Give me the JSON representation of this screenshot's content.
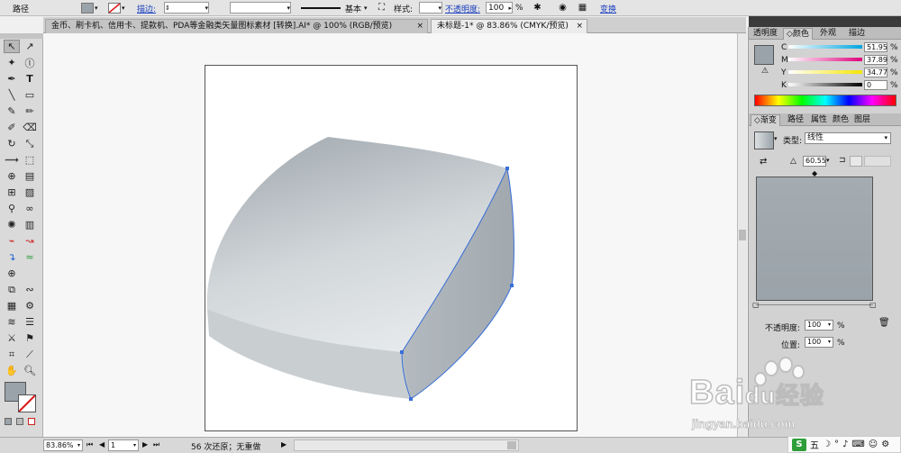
{
  "control_bar": {
    "object_type": "路径",
    "stroke_label": "描边:",
    "stroke_style": "基本",
    "style_label": "样式:",
    "opacity_label": "不透明度:",
    "opacity_value": "100",
    "opacity_unit": "%",
    "transform_label": "变换"
  },
  "tabs": [
    {
      "label": "金币、刷卡机、信用卡、提款机、PDA等金融类矢量图标素材 [转换].AI* @ 100% (RGB/预览)",
      "close": "×"
    },
    {
      "label": "未标题-1* @ 83.86% (CMYK/预览)",
      "close": "×"
    }
  ],
  "color_panel": {
    "tabs": [
      "透明度",
      "颜色",
      "外观",
      "描边"
    ],
    "active_tab": "颜色",
    "channels": [
      {
        "label": "C",
        "value": "51.95"
      },
      {
        "label": "M",
        "value": "37.89"
      },
      {
        "label": "Y",
        "value": "34.77"
      },
      {
        "label": "K",
        "value": "0"
      }
    ],
    "unit": "%",
    "fill_color": "#9aa3a9"
  },
  "gradient_panel": {
    "tabs": [
      "渐变",
      "路径",
      "属性",
      "颜色",
      "图层"
    ],
    "active_tab": "渐变",
    "type_label": "类型:",
    "type_value": "线性",
    "angle_value": "60.55",
    "opacity_label": "不透明度:",
    "opacity_value": "100",
    "location_label": "位置:",
    "location_value": "100",
    "unit": "%"
  },
  "status_bar": {
    "zoom": "83.86%",
    "page": "1",
    "undo_text": "56 次还原；无重做"
  },
  "watermark": {
    "brand": "Bai",
    "brand_suffix": "经验",
    "url": "jingyan.baidu.com"
  },
  "ime_bar": {
    "label": "五"
  },
  "colors": {
    "shape_light": "#e4e8ea",
    "shape_dark": "#9ba3a9",
    "selection": "#3a6fd8"
  }
}
